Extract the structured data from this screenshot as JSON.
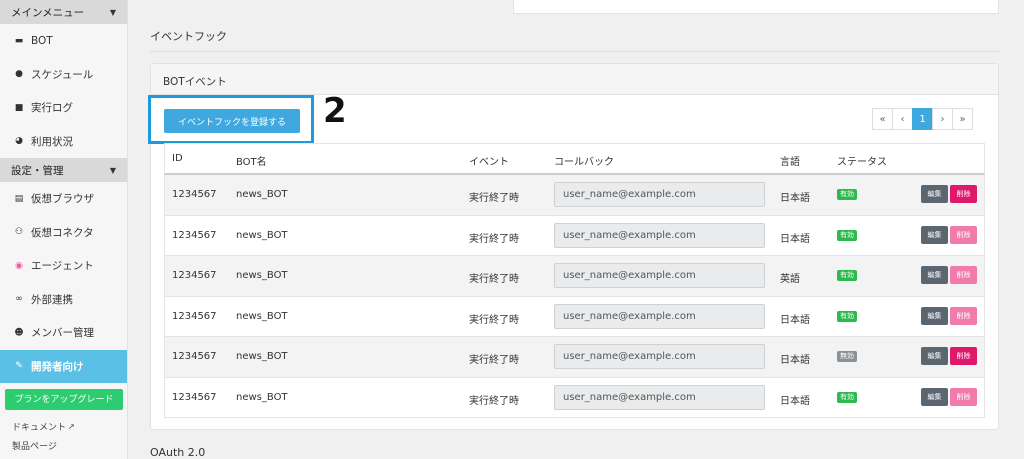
{
  "sidebar": {
    "main_menu": "メインメニュー",
    "items": [
      {
        "label": "BOT",
        "icon": "robot-icon"
      },
      {
        "label": "スケジュール",
        "icon": "clock-icon"
      },
      {
        "label": "実行ログ",
        "icon": "document-icon"
      },
      {
        "label": "利用状況",
        "icon": "pie-chart-icon"
      }
    ],
    "settings_menu": "設定・管理",
    "settings_items": [
      {
        "label": "仮想ブラウザ",
        "icon": "browser-icon"
      },
      {
        "label": "仮想コネクタ",
        "icon": "connector-icon"
      },
      {
        "label": "エージェント",
        "icon": "agent-icon"
      },
      {
        "label": "外部連携",
        "icon": "link-icon"
      },
      {
        "label": "メンバー管理",
        "icon": "users-icon"
      },
      {
        "label": "開発者向け",
        "icon": "wrench-icon"
      }
    ],
    "upgrade_label": "プランをアップグレード",
    "docs_label": "ドキュメント",
    "cutoff_label": "製品ページ"
  },
  "main": {
    "section_title": "イベントフック",
    "card_title": "BOTイベント",
    "register_button": "イベントフックを登録する",
    "step_number": "2",
    "pagination": [
      "«",
      "‹",
      "1",
      "›",
      "»"
    ],
    "oauth_title": "OAuth 2.0"
  },
  "table": {
    "headers": [
      "ID",
      "BOT名",
      "イベント",
      "コールバック",
      "言語",
      "ステータス"
    ],
    "edit_label": "編集",
    "delete_label": "削除",
    "rows": [
      {
        "id": "1234567",
        "bot": "news_BOT",
        "event": "実行終了時",
        "callback": "user_name@example.com",
        "lang": "日本語",
        "status": "有効",
        "status_color": "#2eb84f",
        "delete_color": "#e0186c"
      },
      {
        "id": "1234567",
        "bot": "news_BOT",
        "event": "実行終了時",
        "callback": "user_name@example.com",
        "lang": "日本語",
        "status": "有効",
        "status_color": "#2eb84f",
        "delete_color": "#f17bab"
      },
      {
        "id": "1234567",
        "bot": "news_BOT",
        "event": "実行終了時",
        "callback": "user_name@example.com",
        "lang": "英語",
        "status": "有効",
        "status_color": "#2eb84f",
        "delete_color": "#f17bab"
      },
      {
        "id": "1234567",
        "bot": "news_BOT",
        "event": "実行終了時",
        "callback": "user_name@example.com",
        "lang": "日本語",
        "status": "有効",
        "status_color": "#2eb84f",
        "delete_color": "#f17bab"
      },
      {
        "id": "1234567",
        "bot": "news_BOT",
        "event": "実行終了時",
        "callback": "user_name@example.com",
        "lang": "日本語",
        "status": "無効",
        "status_color": "#8a9096",
        "delete_color": "#e0186c"
      },
      {
        "id": "1234567",
        "bot": "news_BOT",
        "event": "実行終了時",
        "callback": "user_name@example.com",
        "lang": "日本語",
        "status": "有効",
        "status_color": "#2eb84f",
        "delete_color": "#f17bab"
      }
    ]
  },
  "colors": {
    "accent": "#3fa8df",
    "highlight_border": "#1e9bd7",
    "active_sidebar": "#5bc0e6",
    "upgrade": "#2ecc71"
  }
}
